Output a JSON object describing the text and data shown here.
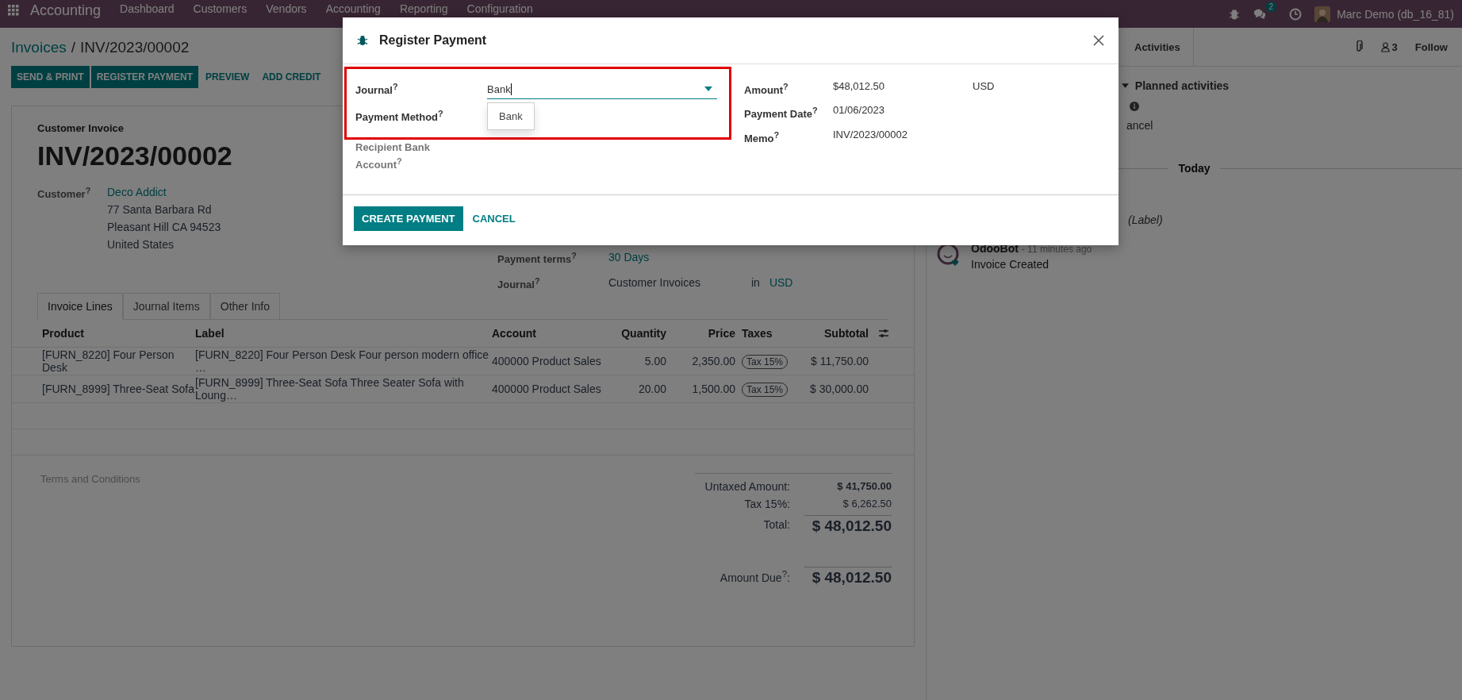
{
  "navbar": {
    "brand": "Accounting",
    "menu": [
      "Dashboard",
      "Customers",
      "Vendors",
      "Accounting",
      "Reporting",
      "Configuration"
    ],
    "message_badge": "2",
    "user": "Marc Demo (db_16_81)"
  },
  "breadcrumb": {
    "parent": "Invoices",
    "separator": "/",
    "current": "INV/2023/00002"
  },
  "actions": [
    {
      "label": "SEND & PRINT",
      "kind": "primary"
    },
    {
      "label": "REGISTER PAYMENT",
      "kind": "primary"
    },
    {
      "label": "PREVIEW",
      "kind": "link"
    },
    {
      "label": "ADD CREDIT",
      "kind": "link"
    }
  ],
  "chatter": {
    "activities_button": "Activities",
    "followers": "3",
    "follow": "Follow",
    "planned_activities": "Planned activities",
    "cancel_fragment": "ancel",
    "date_separator": "Today",
    "label_fragment": "(Label)",
    "message": {
      "author": "OdooBot",
      "time": "- 11 minutes ago",
      "body": "Invoice Created"
    }
  },
  "invoice": {
    "type_label": "Customer Invoice",
    "number": "INV/2023/00002",
    "customer_label": "Customer$^{?}$",
    "customer": "Deco Addict",
    "address": [
      "77 Santa Barbara Rd",
      "Pleasant Hill CA 94523",
      "United States"
    ],
    "payment_terms_label": "Payment terms$^{?}$",
    "payment_terms": "30 Days",
    "journal_label": "Journal$^{?}$",
    "journal": "Customer Invoices",
    "in": "in",
    "currency": "USD"
  },
  "tabs": [
    {
      "label": "Invoice Lines",
      "selected": true
    },
    {
      "label": "Journal Items",
      "selected": false
    },
    {
      "label": "Other Info",
      "selected": false
    }
  ],
  "table": {
    "columns": [
      "Product",
      "Label",
      "Account",
      "Quantity",
      "Price",
      "Taxes",
      "Subtotal"
    ],
    "rows": [
      {
        "product": "[FURN_8220] Four Person Desk",
        "label": "[FURN_8220] Four Person Desk Four person modern office …",
        "account": "400000 Product Sales",
        "quantity": "5.00",
        "price": "2,350.00",
        "tax": "Tax 15%",
        "subtotal": "$ 11,750.00"
      },
      {
        "product": "[FURN_8999] Three-Seat Sofa",
        "label": "[FURN_8999] Three-Seat Sofa Three Seater Sofa with Loung…",
        "account": "400000 Product Sales",
        "quantity": "20.00",
        "price": "1,500.00",
        "tax": "Tax 15%",
        "subtotal": "$ 30,000.00"
      }
    ]
  },
  "terms_placeholder": "Terms and Conditions",
  "totals": {
    "untaxed_label": "Untaxed Amount:",
    "untaxed": "$ 41,750.00",
    "tax_label": "Tax 15%:",
    "tax": "$ 6,262.50",
    "total_label": "Total:",
    "total": "$ 48,012.50",
    "due_label": "Amount Due$^{?}$:",
    "due": "$ 48,012.50"
  },
  "dialog": {
    "title": "Register Payment",
    "journal_label": "Journal$^{?}$",
    "journal_value": "Bank",
    "journal_option": "Bank",
    "method_label": "Payment Method$^{?}$",
    "recipient_label": "Recipient Bank Account$^{?}$",
    "amount_label": "Amount$^{?}$",
    "amount": "$48,012.50",
    "currency": "USD",
    "date_label": "Payment Date$^{?}$",
    "date": "01/06/2023",
    "memo_label": "Memo$^{?}$",
    "memo": "INV/2023/00002",
    "create_button": "CREATE PAYMENT",
    "cancel_button": "CANCEL"
  }
}
